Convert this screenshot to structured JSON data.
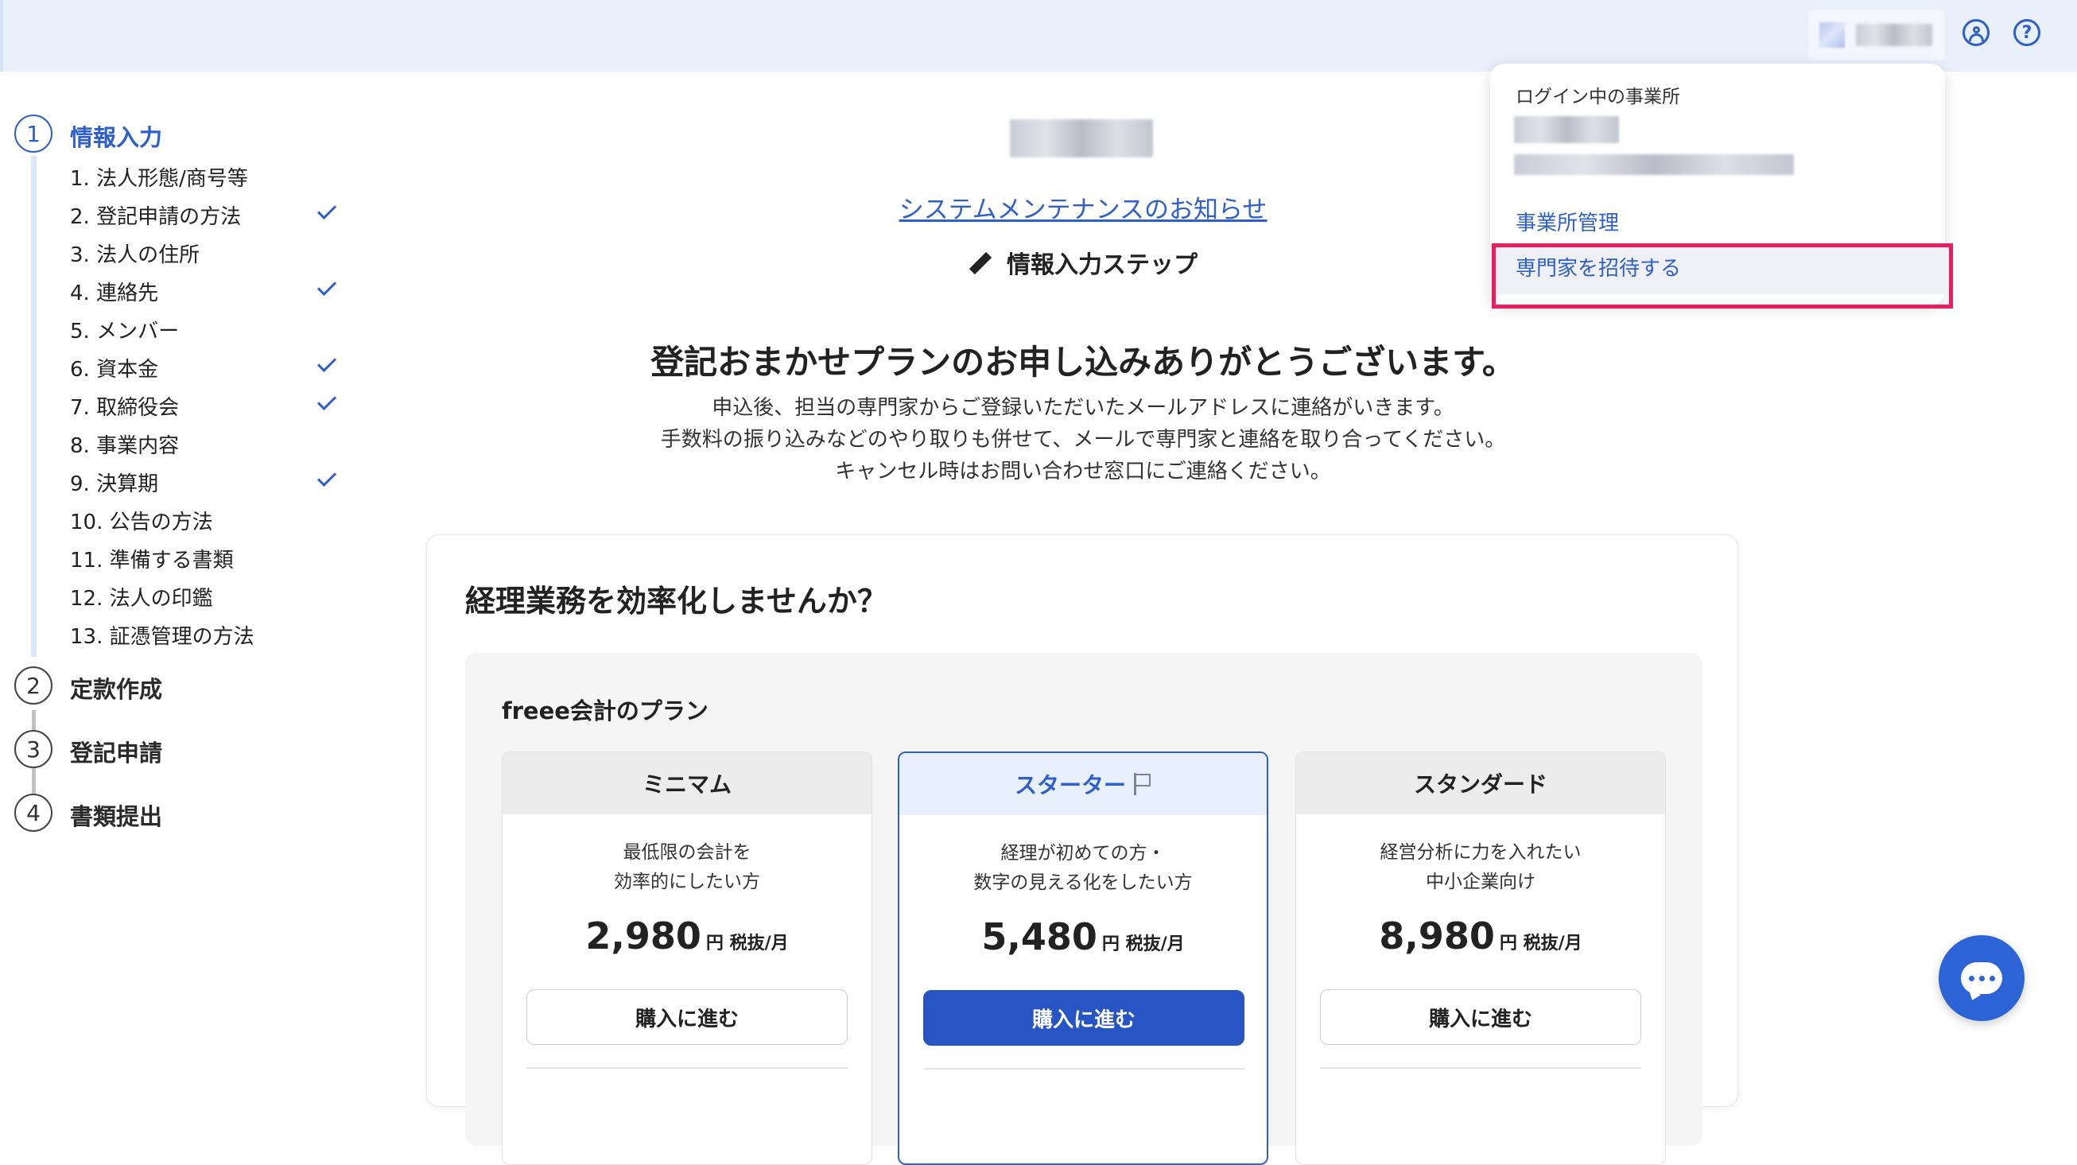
{
  "header": {
    "icons": {
      "user": "user-circle-icon",
      "help": "help-circle-icon"
    },
    "help_glyph": "?"
  },
  "dropdown": {
    "label": "ログイン中の事業所",
    "items": [
      {
        "label": "事業所管理"
      },
      {
        "label": "専門家を招待する"
      }
    ]
  },
  "steps": [
    {
      "number": "1",
      "title": "情報入力",
      "active": true,
      "items": [
        {
          "label": "1. 法人形態/商号等",
          "done": false
        },
        {
          "label": "2. 登記申請の方法",
          "done": true
        },
        {
          "label": "3. 法人の住所",
          "done": false
        },
        {
          "label": "4. 連絡先",
          "done": true
        },
        {
          "label": "5. メンバー",
          "done": false
        },
        {
          "label": "6. 資本金",
          "done": true
        },
        {
          "label": "7. 取締役会",
          "done": true
        },
        {
          "label": "8. 事業内容",
          "done": false
        },
        {
          "label": "9. 決算期",
          "done": true
        },
        {
          "label": "10. 公告の方法",
          "done": false
        },
        {
          "label": "11. 準備する書類",
          "done": false
        },
        {
          "label": "12. 法人の印鑑",
          "done": false
        },
        {
          "label": "13. 証憑管理の方法",
          "done": false
        }
      ]
    },
    {
      "number": "2",
      "title": "定款作成",
      "active": false
    },
    {
      "number": "3",
      "title": "登記申請",
      "active": false
    },
    {
      "number": "4",
      "title": "書類提出",
      "active": false
    }
  ],
  "main": {
    "notice_link": "システムメンテナンスのお知らせ",
    "steps_heading": "情報入力ステップ",
    "thanks_heading": "登記おまかせプランのお申し込みありがとうございます。",
    "description": [
      "申込後、担当の専門家からご登録いただいたメールアドレスに連絡がいきます。",
      "手数料の振り込みなどのやり取りも併せて、メールで専門家と連絡を取り合ってください。",
      "キャンセル時はお問い合わせ窓口にご連絡ください。"
    ]
  },
  "promo": {
    "title": "経理業務を効率化しませんか？",
    "plans_label": "freee会計のプラン",
    "plans": [
      {
        "name": "ミニマム",
        "desc1": "最低限の会計を",
        "desc2": "効率的にしたい方",
        "price": "2,980",
        "unit": "円 税抜/月",
        "button": "購入に進む"
      },
      {
        "name": "スターター",
        "desc1": "経理が初めての方・",
        "desc2": "数字の見える化をしたい方",
        "price": "5,480",
        "unit": "円 税抜/月",
        "button": "購入に進む"
      },
      {
        "name": "スタンダード",
        "desc1": "経営分析に力を入れたい",
        "desc2": "中小企業向け",
        "price": "8,980",
        "unit": "円 税抜/月",
        "button": "購入に進む"
      }
    ]
  },
  "colors": {
    "accent": "#2f5fc9",
    "highlight": "#ec1c5e",
    "header_bg": "#e9effb"
  }
}
